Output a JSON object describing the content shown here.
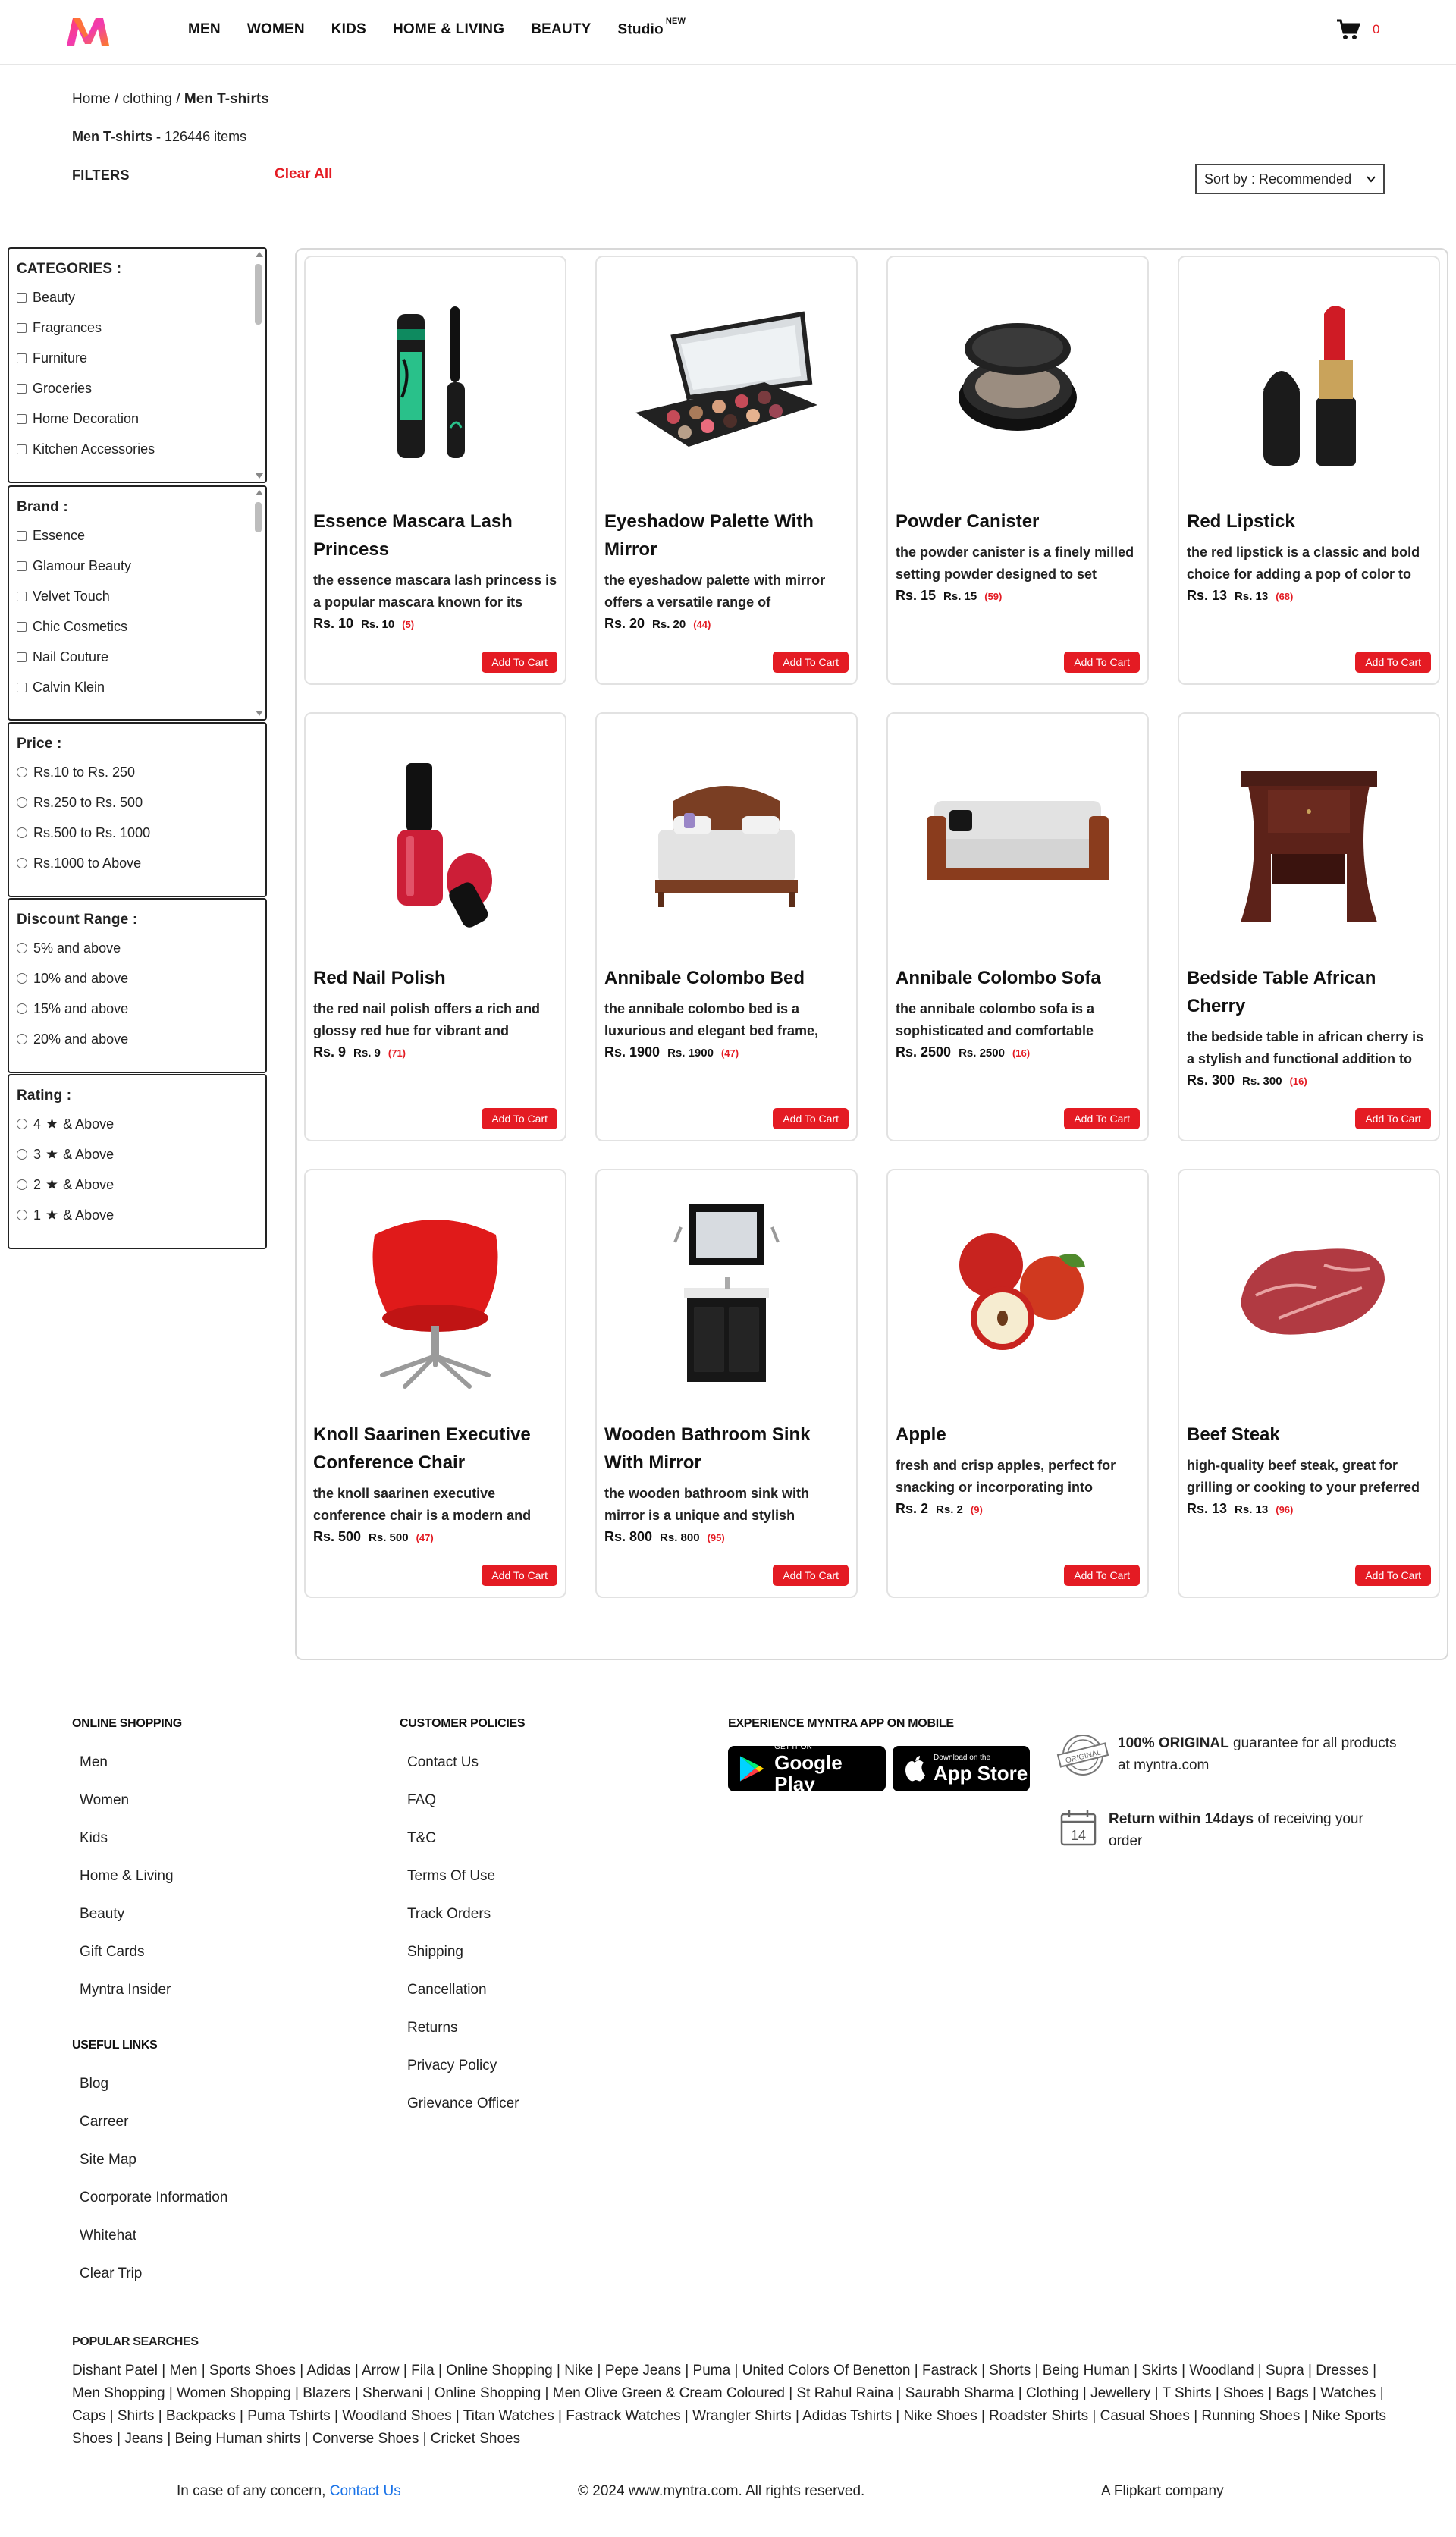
{
  "header": {
    "nav": [
      "MEN",
      "WOMEN",
      "KIDS",
      "HOME & LIVING",
      "BEAUTY",
      "Studio"
    ],
    "studio_badge": "NEW",
    "cart_count": "0",
    "brand_color": "#e41b23"
  },
  "breadcrumb": {
    "home": "Home",
    "sep1": "/",
    "clothing": "clothing",
    "sep2": "/",
    "current": "Men T-shirts"
  },
  "results": {
    "title": "Men T-shirts -",
    "count": "126446 items"
  },
  "filters": {
    "label": "FILTERS",
    "clear_all": "Clear All",
    "sort_label": "Sort by : Recommended",
    "categories": {
      "title": "CATEGORIES :",
      "options": [
        "Beauty",
        "Fragrances",
        "Furniture",
        "Groceries",
        "Home Decoration",
        "Kitchen Accessories"
      ]
    },
    "brand": {
      "title": "Brand :",
      "options": [
        "Essence",
        "Glamour Beauty",
        "Velvet Touch",
        "Chic Cosmetics",
        "Nail Couture",
        "Calvin Klein"
      ]
    },
    "price": {
      "title": "Price :",
      "options": [
        "Rs.10 to Rs. 250",
        "Rs.250 to Rs. 500",
        "Rs.500 to Rs. 1000",
        "Rs.1000 to Above"
      ]
    },
    "discount": {
      "title": "Discount Range :",
      "options": [
        "5% and above",
        "10% and above",
        "15% and above",
        "20% and above"
      ]
    },
    "rating": {
      "title": "Rating :",
      "options": [
        {
          "num": "4",
          "suffix": "& Above"
        },
        {
          "num": "3",
          "suffix": "& Above"
        },
        {
          "num": "2",
          "suffix": "& Above"
        },
        {
          "num": "1",
          "suffix": "& Above"
        }
      ]
    }
  },
  "products": [
    {
      "name": "Essence Mascara Lash Princess",
      "desc": "the essence mascara lash princess is a popular mascara known for its",
      "price": "Rs. 10",
      "mrp": "Rs. 10",
      "reviews": "(5)",
      "btn": "Add To Cart",
      "icon": "mascara-icon"
    },
    {
      "name": "Eyeshadow Palette With Mirror",
      "desc": "the eyeshadow palette with mirror offers a versatile range of",
      "price": "Rs. 20",
      "mrp": "Rs. 20",
      "reviews": "(44)",
      "btn": "Add To Cart",
      "icon": "eyeshadow-palette-icon"
    },
    {
      "name": "Powder Canister",
      "desc": "the powder canister is a finely milled setting powder designed to set",
      "price": "Rs. 15",
      "mrp": "Rs. 15",
      "reviews": "(59)",
      "btn": "Add To Cart",
      "icon": "powder-canister-icon"
    },
    {
      "name": "Red Lipstick",
      "desc": "the red lipstick is a classic and bold choice for adding a pop of color to",
      "price": "Rs. 13",
      "mrp": "Rs. 13",
      "reviews": "(68)",
      "btn": "Add To Cart",
      "icon": "lipstick-icon"
    },
    {
      "name": "Red Nail Polish",
      "desc": "the red nail polish offers a rich and glossy red hue for vibrant and",
      "price": "Rs. 9",
      "mrp": "Rs. 9",
      "reviews": "(71)",
      "btn": "Add To Cart",
      "icon": "nail-polish-icon"
    },
    {
      "name": "Annibale Colombo Bed",
      "desc": "the annibale colombo bed is a luxurious and elegant bed frame,",
      "price": "Rs. 1900",
      "mrp": "Rs. 1900",
      "reviews": "(47)",
      "btn": "Add To Cart",
      "icon": "bed-icon"
    },
    {
      "name": "Annibale Colombo Sofa",
      "desc": "the annibale colombo sofa is a sophisticated and comfortable",
      "price": "Rs. 2500",
      "mrp": "Rs. 2500",
      "reviews": "(16)",
      "btn": "Add To Cart",
      "icon": "sofa-icon"
    },
    {
      "name": "Bedside Table African Cherry",
      "desc": "the bedside table in african cherry is a stylish and functional addition to",
      "price": "Rs. 300",
      "mrp": "Rs. 300",
      "reviews": "(16)",
      "btn": "Add To Cart",
      "icon": "bedside-table-icon"
    },
    {
      "name": "Knoll Saarinen Executive Conference Chair",
      "desc": "the knoll saarinen executive conference chair is a modern and",
      "price": "Rs. 500",
      "mrp": "Rs. 500",
      "reviews": "(47)",
      "btn": "Add To Cart",
      "icon": "chair-icon"
    },
    {
      "name": "Wooden Bathroom Sink With Mirror",
      "desc": "the wooden bathroom sink with mirror is a unique and stylish",
      "price": "Rs. 800",
      "mrp": "Rs. 800",
      "reviews": "(95)",
      "btn": "Add To Cart",
      "icon": "bathroom-sink-icon"
    },
    {
      "name": "Apple",
      "desc": "fresh and crisp apples, perfect for snacking or incorporating into",
      "price": "Rs. 2",
      "mrp": "Rs. 2",
      "reviews": "(9)",
      "btn": "Add To Cart",
      "icon": "apple-icon"
    },
    {
      "name": "Beef Steak",
      "desc": "high-quality beef steak, great for grilling or cooking to your preferred",
      "price": "Rs. 13",
      "mrp": "Rs. 13",
      "reviews": "(96)",
      "btn": "Add To Cart",
      "icon": "steak-icon"
    }
  ],
  "footer": {
    "online_shopping": {
      "title": "ONLINE SHOPPING",
      "links": [
        "Men",
        "Women",
        "Kids",
        "Home & Living",
        "Beauty",
        "Gift Cards",
        "Myntra Insider"
      ]
    },
    "useful_links": {
      "title": "USEFUL LINKS",
      "links": [
        "Blog",
        "Carreer",
        "Site Map",
        "Coorporate Information",
        "Whitehat",
        "Clear Trip"
      ]
    },
    "customer_policies": {
      "title": "CUSTOMER POLICIES",
      "links": [
        "Contact Us",
        "FAQ",
        "T&C",
        "Terms Of Use",
        "Track Orders",
        "Shipping",
        "Cancellation",
        "Returns",
        "Privacy Policy",
        "Grievance Officer"
      ]
    },
    "app": {
      "title": "EXPERIENCE MYNTRA APP ON MOBILE",
      "google_small": "GET IT ON",
      "google_big": "Google Play",
      "apple_small": "Download on the",
      "apple_big": "App Store"
    },
    "original": {
      "bold": "100% ORIGINAL",
      "rest": "guarantee for all products at myntra.com",
      "badge": "ORIGINAL"
    },
    "returns": {
      "bold": "Return within 14days",
      "rest": "of receiving your order",
      "badge": "14"
    },
    "popular": {
      "title": "POPULAR SEARCHES",
      "text": "Dishant Patel | Men | Sports Shoes | Adidas | Arrow | Fila | Online Shopping | Nike | Pepe Jeans | Puma | United Colors Of Benetton | Fastrack | Shorts | Being Human | Skirts | Woodland | Supra | Dresses | Men Shopping | Women Shopping | Blazers | Sherwani | Online Shopping | Men Olive Green & Cream Coloured | St Rahul Raina | Saurabh Sharma | Clothing | Jewellery | T Shirts | Shoes | Bags | Watches | Caps | Shirts | Backpacks | Puma Tshirts | Woodland Shoes | Titan Watches | Fastrack Watches | Wrangler Shirts | Adidas Tshirts | Nike Shoes | Roadster Shirts | Casual Shoes | Running Shoes | Nike Sports Shoes | Jeans | Being Human shirts | Converse Shoes | Cricket Shoes"
    },
    "bottom": {
      "concern": "In case of any concern,",
      "contact": "Contact Us",
      "copyright": "© 2024 www.myntra.com. All rights reserved.",
      "company": "A Flipkart company"
    }
  }
}
